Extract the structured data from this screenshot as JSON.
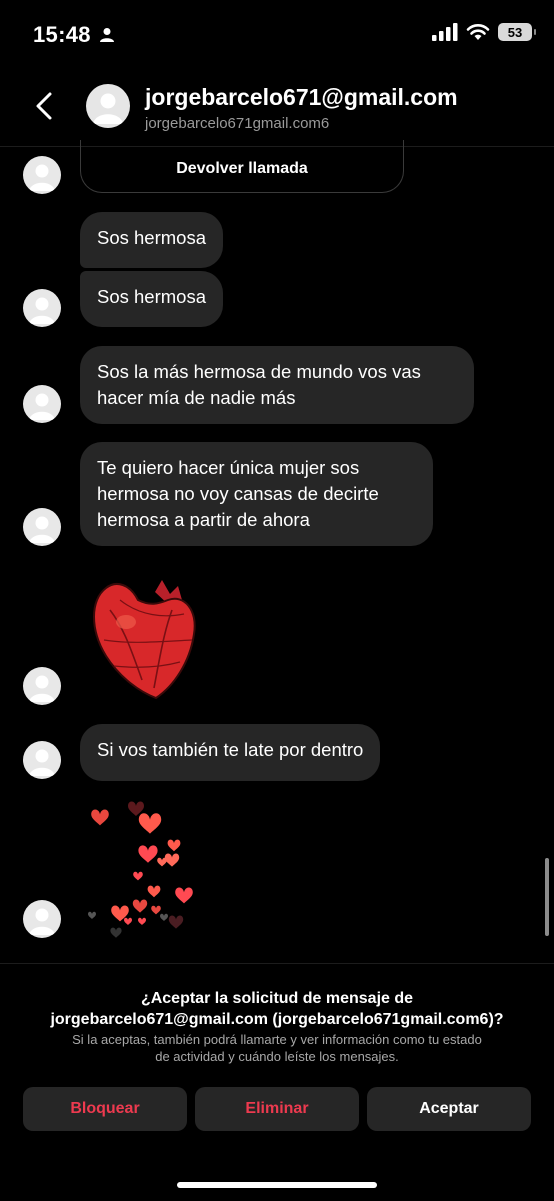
{
  "status_bar": {
    "time": "15:48",
    "battery": "53",
    "icons": [
      "person-icon",
      "signal-icon",
      "wifi-icon",
      "battery-icon"
    ]
  },
  "header": {
    "title": "jorgebarcelo671@gmail.com",
    "subtitle": "jorgebarcelo671gmail.com6",
    "icons": [
      "back-chevron-icon",
      "avatar-placeholder-icon"
    ]
  },
  "messages": {
    "call_card": "Devolver llamada",
    "m1": "Sos hermosa",
    "m2": "Sos hermosa",
    "m3_l1": "Sos la más hermosa de mundo vos vas",
    "m3_l2": "hacer mía de nadie más",
    "m4_l1": "Te quiero hacer única mujer sos",
    "m4_l2": "hermosa no voy cansas de decirte",
    "m4_l3": "hermosa a partir de ahora",
    "m5": "Si vos también te late por dentro",
    "stickers": [
      "anatomical-heart-sticker",
      "floating-hearts-sticker"
    ]
  },
  "request": {
    "title_l1": "¿Aceptar la solicitud de mensaje de",
    "title_l2": "jorgebarcelo671@gmail.com (jorgebarcelo671gmail.com6)?",
    "desc_l1": "Si la aceptas, también podrá llamarte y ver información como tu estado",
    "desc_l2": "de actividad y cuándo leíste los mensajes.",
    "block": "Bloquear",
    "delete": "Eliminar",
    "accept": "Aceptar"
  },
  "colors": {
    "background": "#000000",
    "bubble": "#262626",
    "danger": "#ed3a4f",
    "secondary_text": "#9a9a9a"
  }
}
